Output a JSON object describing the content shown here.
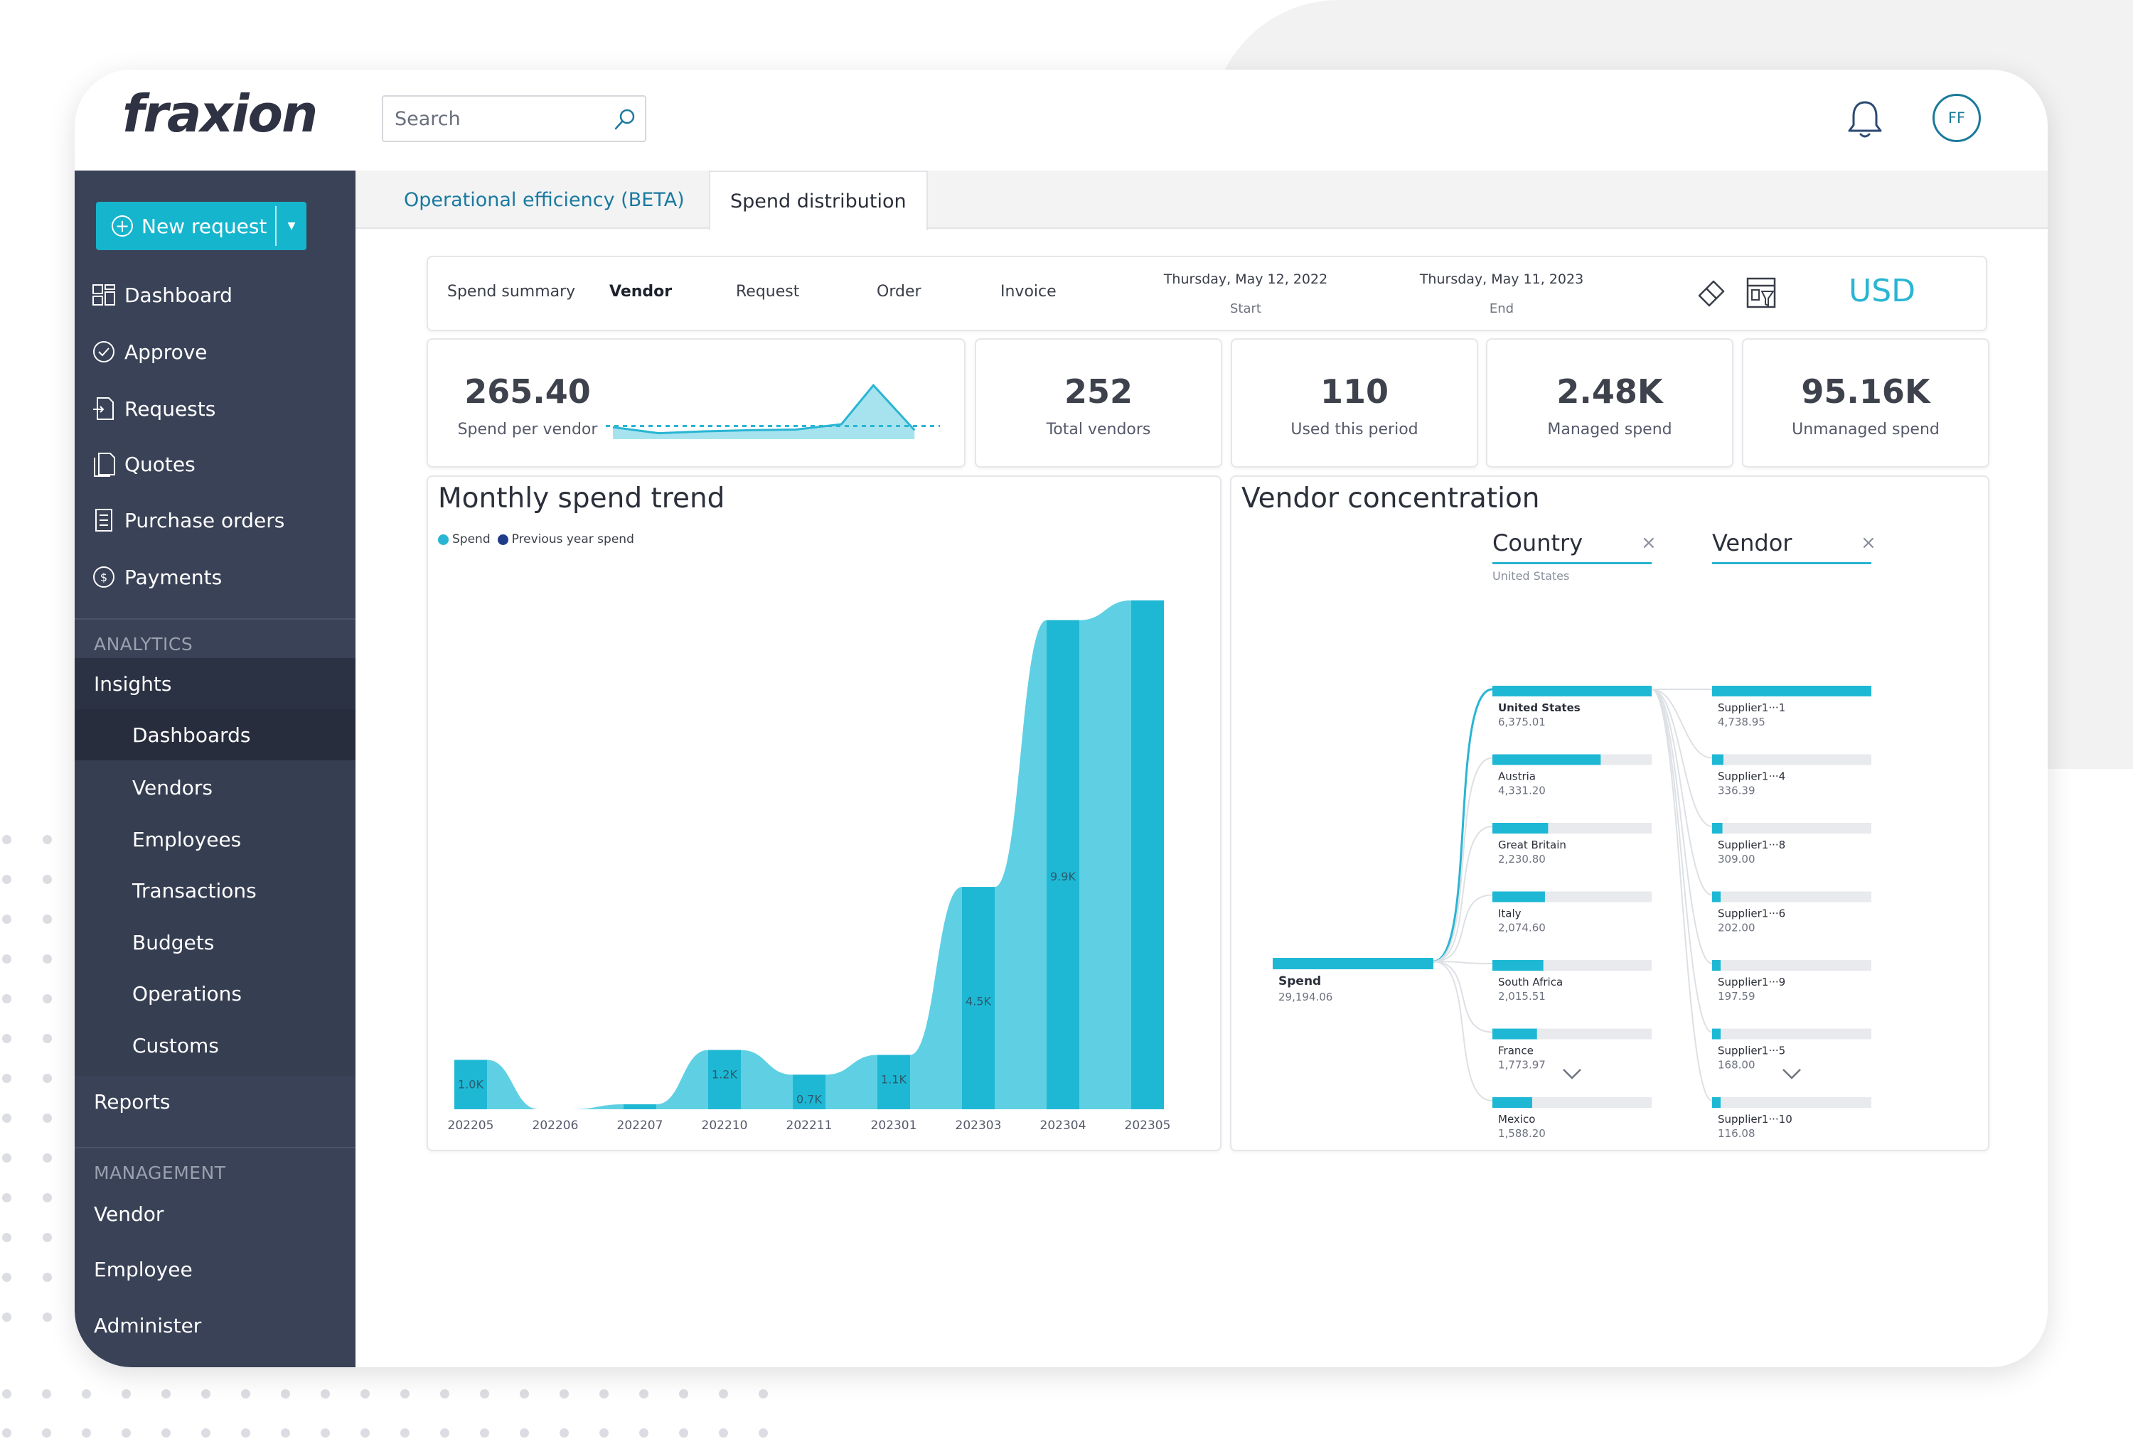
{
  "app": {
    "logo": "fraxion",
    "search_placeholder": "Search",
    "user_initials": "FF"
  },
  "sidebar": {
    "new_request": "New request",
    "nav": [
      {
        "label": "Dashboard",
        "icon": "dashboard-icon"
      },
      {
        "label": "Approve",
        "icon": "check-circle-icon"
      },
      {
        "label": "Requests",
        "icon": "request-doc-icon"
      },
      {
        "label": "Quotes",
        "icon": "quote-doc-icon"
      },
      {
        "label": "Purchase orders",
        "icon": "list-doc-icon"
      },
      {
        "label": "Payments",
        "icon": "dollar-circle-icon"
      }
    ],
    "analytics_label": "ANALYTICS",
    "insights": "Insights",
    "insights_sub": [
      "Dashboards",
      "Vendors",
      "Employees",
      "Transactions",
      "Budgets",
      "Operations",
      "Customs"
    ],
    "reports": "Reports",
    "management_label": "MANAGEMENT",
    "management": [
      "Vendor",
      "Employee",
      "Administer"
    ]
  },
  "tabs": [
    "Operational efficiency (BETA)",
    "Spend distribution"
  ],
  "filters": {
    "items": [
      "Spend summary",
      "Vendor",
      "Request",
      "Order",
      "Invoice"
    ],
    "start_date": "Thursday, May 12, 2022",
    "start_label": "Start",
    "end_date": "Thursday, May 11, 2023",
    "end_label": "End",
    "currency": "USD"
  },
  "kpis": [
    {
      "value": "265.40",
      "label": "Spend per vendor"
    },
    {
      "value": "252",
      "label": "Total vendors"
    },
    {
      "value": "110",
      "label": "Used this period"
    },
    {
      "value": "2.48K",
      "label": "Managed spend"
    },
    {
      "value": "95.16K",
      "label": "Unmanaged spend"
    }
  ],
  "sparkline": {
    "values": [
      2,
      1,
      1.3,
      1.5,
      1.6,
      2.5,
      9,
      1.5
    ],
    "baseline": 2.2
  },
  "monthly": {
    "title": "Monthly spend trend",
    "legend": [
      {
        "name": "Spend",
        "color": "#29b5d3"
      },
      {
        "name": "Previous year spend",
        "color": "#1f3b8a"
      }
    ]
  },
  "chart_data": {
    "type": "area",
    "title": "Monthly spend trend",
    "categories": [
      "202205",
      "202206",
      "202207",
      "202210",
      "202211",
      "202301",
      "202303",
      "202304",
      "202305"
    ],
    "series": [
      {
        "name": "Spend",
        "values": [
          1.0,
          0,
          0.1,
          1.2,
          0.7,
          1.1,
          4.5,
          9.9,
          10.3
        ]
      }
    ],
    "data_labels": [
      "1.0K",
      "",
      "",
      "1.2K",
      "0.7K",
      "1.1K",
      "4.5K",
      "9.9K",
      ""
    ],
    "unit": "K",
    "ylim": [
      0,
      10.5
    ]
  },
  "vendor_concentration": {
    "title": "Vendor concentration",
    "country_header": "Country",
    "country_filter": "United States",
    "vendor_header": "Vendor",
    "root": {
      "label": "Spend",
      "value": "29,194.06"
    },
    "countries": [
      {
        "name": "United States",
        "value": "6,375.01",
        "fill": 1.0
      },
      {
        "name": "Austria",
        "value": "4,331.20",
        "fill": 0.68
      },
      {
        "name": "Great Britain",
        "value": "2,230.80",
        "fill": 0.35
      },
      {
        "name": "Italy",
        "value": "2,074.60",
        "fill": 0.33
      },
      {
        "name": "South Africa",
        "value": "2,015.51",
        "fill": 0.32
      },
      {
        "name": "France",
        "value": "1,773.97",
        "fill": 0.28
      },
      {
        "name": "Mexico",
        "value": "1,588.20",
        "fill": 0.25
      }
    ],
    "vendors": [
      {
        "name": "Supplier1···1",
        "value": "4,738.95",
        "fill": 1.0
      },
      {
        "name": "Supplier1···4",
        "value": "336.39",
        "fill": 0.071
      },
      {
        "name": "Supplier1···8",
        "value": "309.00",
        "fill": 0.065
      },
      {
        "name": "Supplier1···6",
        "value": "202.00",
        "fill": 0.043
      },
      {
        "name": "Supplier1···9",
        "value": "197.59",
        "fill": 0.042
      },
      {
        "name": "Supplier1···5",
        "value": "168.00",
        "fill": 0.035
      },
      {
        "name": "Supplier1···10",
        "value": "116.08",
        "fill": 0.024
      }
    ]
  }
}
